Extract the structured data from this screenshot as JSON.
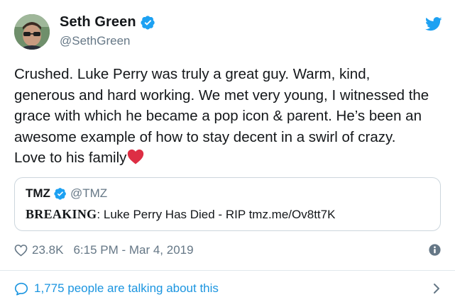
{
  "author": {
    "display_name": "Seth Green",
    "handle": "@SethGreen",
    "verified": true
  },
  "tweet": {
    "lines": [
      "Crushed. Luke Perry was truly a great guy. Warm, kind,",
      "generous and hard working. We met very young, I witnessed the",
      "grace with which he became a pop icon & parent. He’s been an",
      "awesome example of how to stay decent in a swirl of crazy.",
      "Love to his family"
    ]
  },
  "quoted": {
    "display_name": "TMZ",
    "handle": "@TMZ",
    "verified": true,
    "text_strong": "BREAKING",
    "text_rest": ": Luke Perry Has Died - RIP tmz.me/Ov8tt7K"
  },
  "meta": {
    "likes": "23.8K",
    "timestamp": "6:15 PM - Mar 4, 2019"
  },
  "footer": {
    "conversation": "1,775 people are talking about this"
  },
  "colors": {
    "accent": "#1da1f2",
    "link": "#1b95e0",
    "muted": "#657786",
    "heart": "#e0245e"
  },
  "icons": [
    "verified-badge-icon",
    "twitter-bird-icon",
    "heart-outline-icon",
    "info-icon",
    "speech-bubble-icon",
    "chevron-right-icon",
    "red-heart-emoji"
  ]
}
